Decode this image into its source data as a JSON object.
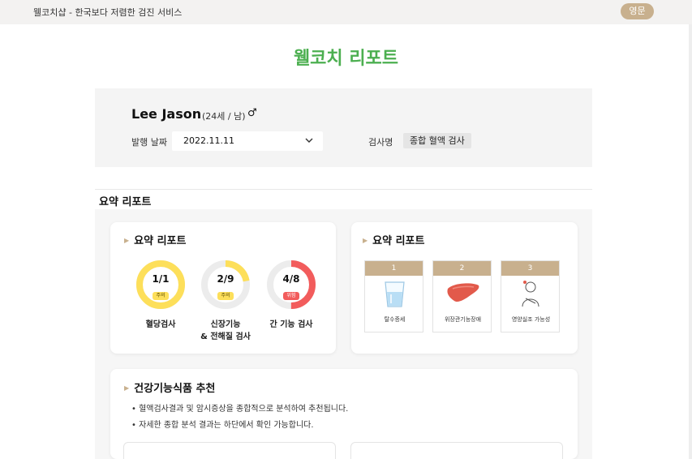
{
  "topbar": {
    "site_title": "웰코치샵 - 한국보다 저렴한 검진 서비스",
    "lang_button": "영문"
  },
  "page_title": "웰코치 리포트",
  "profile": {
    "name": "Lee Jason",
    "age_gender": "(24세 / 남)",
    "gender_icon": "male-icon",
    "date_label": "발행 날짜",
    "date_value": "2022.11.11",
    "test_label": "검사명",
    "test_name": "종합 혈액 검사"
  },
  "summary_section_title": "요약 리포트",
  "summary_card_left": {
    "title": "요약 리포트",
    "rings": [
      {
        "fraction": "1/1",
        "badge": "주의",
        "status": "caution",
        "progress": 1.0,
        "color": "#fddf5a",
        "label_line1": "혈당검사",
        "label_line2": ""
      },
      {
        "fraction": "2/9",
        "badge": "주의",
        "status": "caution",
        "progress": 0.222,
        "color": "#fddf5a",
        "label_line1": "신장기능",
        "label_line2": "& 전해질 검사"
      },
      {
        "fraction": "4/8",
        "badge": "위험",
        "status": "danger",
        "progress": 0.5,
        "color": "#f25c5c",
        "label_line1": "간 기능 검사",
        "label_line2": ""
      }
    ]
  },
  "summary_card_right": {
    "title": "요약 리포트",
    "symptoms": [
      {
        "number": "1",
        "caption": "탈수증세",
        "icon": "water-glass-icon"
      },
      {
        "number": "2",
        "caption": "위장관기능장애",
        "icon": "liver-icon"
      },
      {
        "number": "3",
        "caption": "영양실조 가능성",
        "icon": "sick-person-icon"
      }
    ]
  },
  "recommend": {
    "title": "건강기능식품 추천",
    "notes": [
      "• 혈액검사결과 및 암시증상을 종합적으로 분석하여 추천됩니다.",
      "• 자세한 종합 분석 결과는 하단에서 확인 가능합니다."
    ]
  },
  "colors": {
    "accent_green": "#4caf50",
    "accent_tan": "#c8b08e",
    "caution_yellow": "#fddf5a",
    "danger_red": "#f25c5c",
    "ring_track": "#ececec"
  }
}
